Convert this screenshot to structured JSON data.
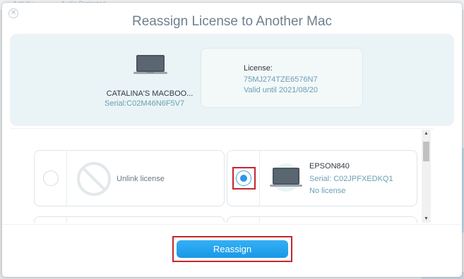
{
  "background": {
    "tab_left": "Activity",
    "tab_right": "Audio Protected"
  },
  "dialog": {
    "title": "Reassign License to Another Mac",
    "close_icon": "close-icon"
  },
  "current_mac": {
    "name": "CATALINA'S MACBOO...",
    "serial": "Serial:C02M46N6F5V7",
    "icon": "laptop-icon"
  },
  "license": {
    "label": "License:",
    "key": "75MJ274TZE6576N7",
    "valid": "Valid until 2021/08/20"
  },
  "options": [
    {
      "type": "unlink",
      "label": "Unlink license",
      "selected": false,
      "icon": "unlink-icon"
    },
    {
      "type": "device",
      "name": "EPSON840",
      "serial": "Serial: C02JPFXEDKQ1",
      "status": "No license",
      "selected": true,
      "icon": "laptop-icon"
    }
  ],
  "footer": {
    "reassign_label": "Reassign"
  },
  "colors": {
    "accent": "#2f96e6",
    "highlight": "#c4262e",
    "title": "#6e7f8f",
    "secondary_text": "#6aa0b4"
  }
}
